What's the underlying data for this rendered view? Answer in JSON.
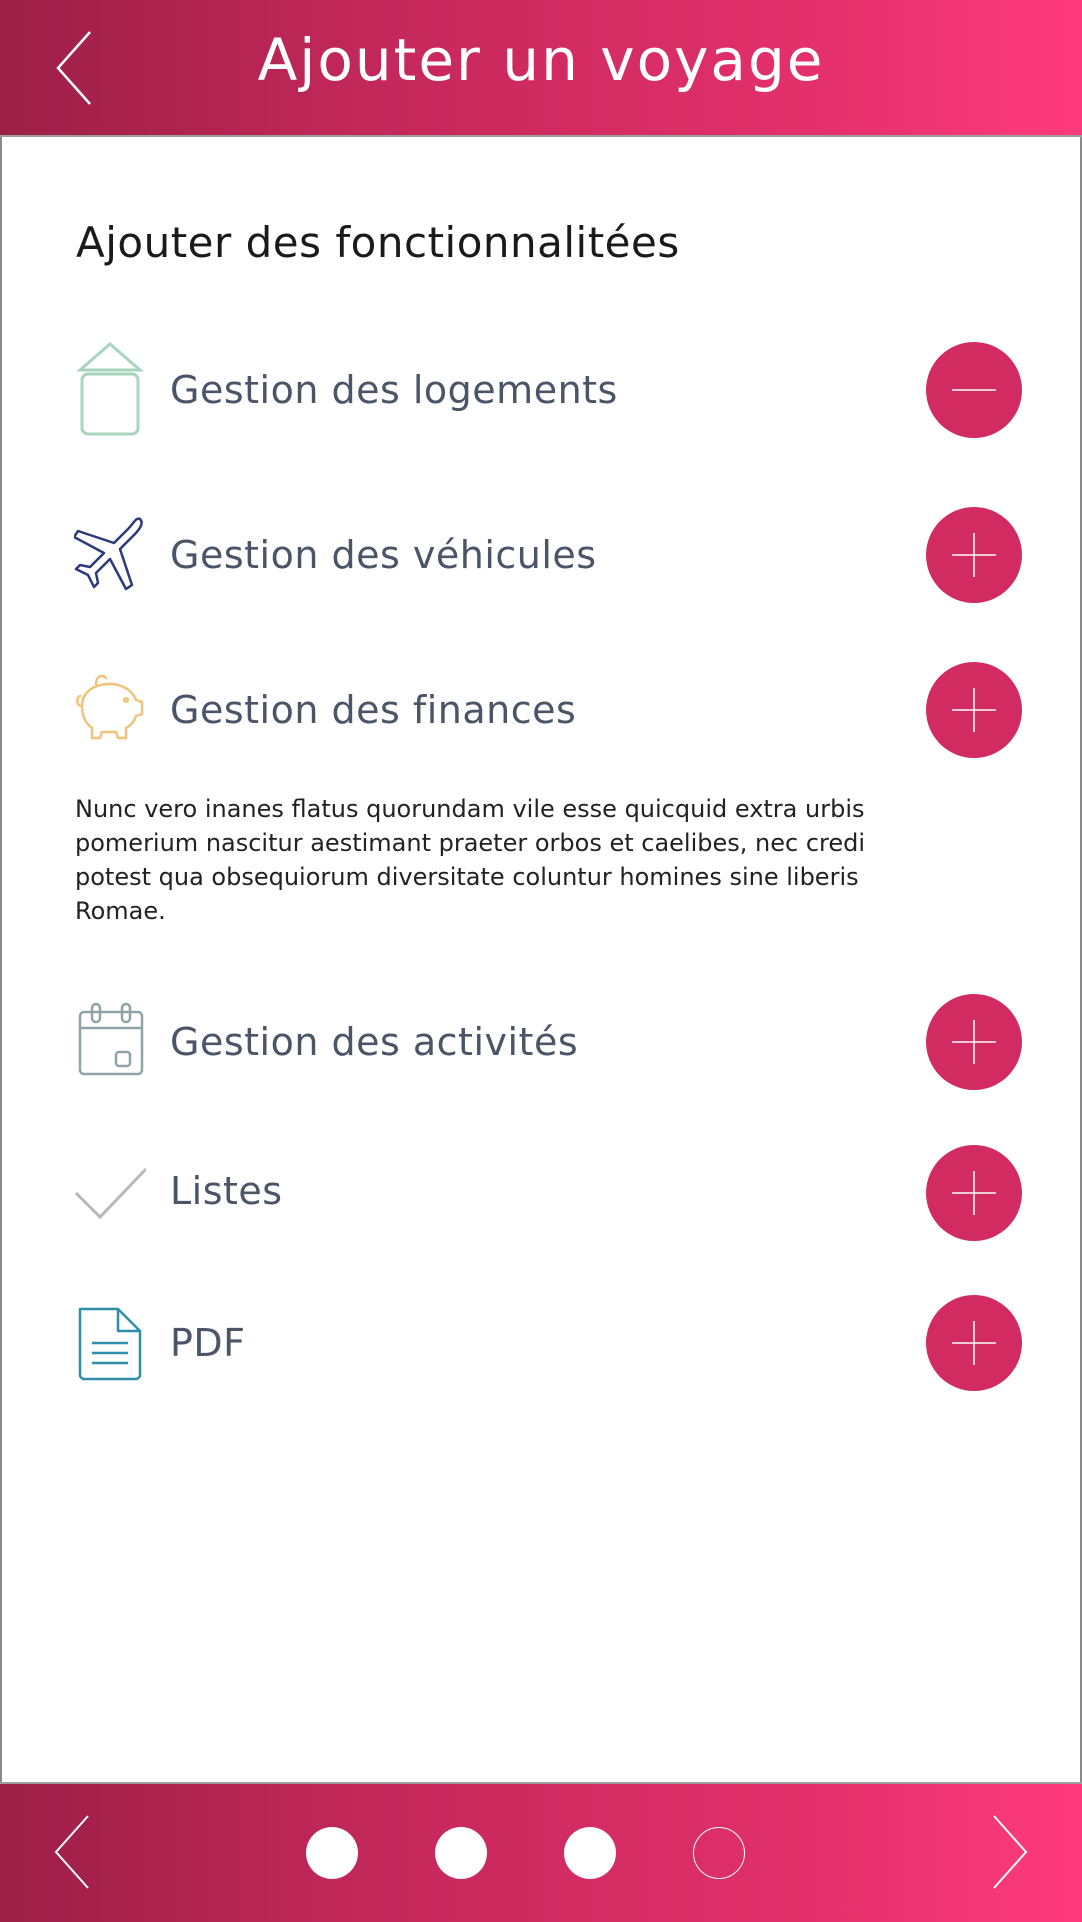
{
  "header": {
    "title": "Ajouter un voyage",
    "back_icon": "chevron-left-icon"
  },
  "section": {
    "title": "Ajouter des fonctionnalitées"
  },
  "features": [
    {
      "label": "Gestion des logements",
      "icon": "house-icon",
      "icon_color": "#a8d5bd",
      "action": "minus"
    },
    {
      "label": "Gestion des véhicules",
      "icon": "airplane-icon",
      "icon_color": "#2b3a7a",
      "action": "plus"
    },
    {
      "label": "Gestion des finances",
      "icon": "piggy-bank-icon",
      "icon_color": "#f0c27a",
      "action": "plus"
    },
    {
      "label": "Gestion des activités",
      "icon": "calendar-icon",
      "icon_color": "#8fa4a8",
      "action": "plus"
    },
    {
      "label": "Listes",
      "icon": "checkmark-icon",
      "icon_color": "#b8b8b8",
      "action": "plus"
    },
    {
      "label": "PDF",
      "icon": "document-icon",
      "icon_color": "#2e8fa8",
      "action": "plus"
    }
  ],
  "description": "Nunc vero inanes flatus quorundam vile esse quicquid extra urbis pomerium nascitur aestimant praeter orbos et caelibes, nec credi potest qua obsequiorum diversitate coluntur homines sine liberis Romae.",
  "pager": {
    "steps": [
      {
        "state": "filled"
      },
      {
        "state": "filled"
      },
      {
        "state": "filled"
      },
      {
        "state": "empty"
      }
    ],
    "prev_icon": "chevron-left-icon",
    "next_icon": "chevron-right-icon"
  },
  "colors": {
    "accent": "#d12b61",
    "gradient_start": "#9c1f48",
    "gradient_end": "#ff3a7c"
  }
}
